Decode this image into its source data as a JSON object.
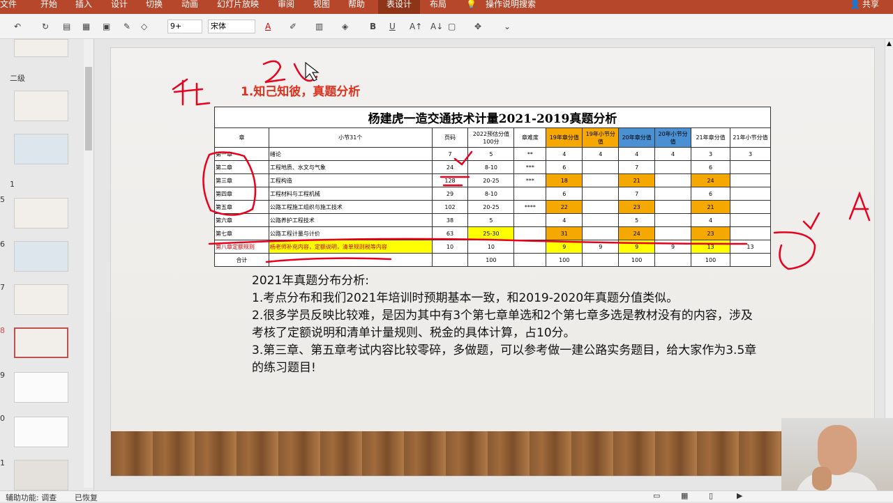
{
  "ribbon": {
    "tabs": [
      "文件",
      "开始",
      "插入",
      "设计",
      "切换",
      "动画",
      "幻灯片放映",
      "审阅",
      "视图",
      "帮助",
      "表设计",
      "布局"
    ],
    "search": "操作说明搜索",
    "share": "共享"
  },
  "toolbar": {
    "font_size": "9+",
    "font_name": "宋体"
  },
  "thumbs": {
    "labels": [
      "二级",
      "1",
      "5",
      "6",
      "7",
      "8",
      "9",
      "0",
      "1"
    ]
  },
  "status": {
    "accessibility": "辅助功能: 调查",
    "restored": "已恢复"
  },
  "slide": {
    "subtitle": "1.知己知彼，真题分析",
    "table_title": "杨建虎一造交通技术计量2021-2019真题分析",
    "headers": [
      "章",
      "小节31个",
      "页码",
      "2022预估分值100分",
      "章难度",
      "19年章分值",
      "19年小节分值",
      "20年章分值",
      "20年小节分值",
      "21年章分值",
      "21年小节分值"
    ],
    "rows": [
      [
        "第一章",
        "绪论",
        "7",
        "5",
        "**",
        "4",
        "4",
        "4",
        "4",
        "3",
        "3"
      ],
      [
        "第二章",
        "工程地质、水文与气象",
        "24",
        "8-10",
        "***",
        "6",
        "",
        "7",
        "",
        "6",
        ""
      ],
      [
        "第三章",
        "工程构造",
        "128",
        "20-25",
        "***",
        "18",
        "",
        "21",
        "",
        "24",
        ""
      ],
      [
        "第四章",
        "工程材料与工程机械",
        "29",
        "8-10",
        "",
        "6",
        "",
        "7",
        "",
        "6",
        ""
      ],
      [
        "第五章",
        "公路工程施工组织与施工技术",
        "102",
        "20-25",
        "****",
        "22",
        "",
        "23",
        "",
        "21",
        ""
      ],
      [
        "第六章",
        "公路养护工程技术",
        "38",
        "5",
        "",
        "4",
        "",
        "5",
        "",
        "4",
        ""
      ],
      [
        "第七章",
        "公路工程计量与计价",
        "63",
        "25-30",
        "",
        "31",
        "",
        "24",
        "",
        "23",
        ""
      ],
      [
        "第八章定额规则",
        "杨老师补充内容，定额说明，清单规则税等内容",
        "10",
        "10",
        "",
        "9",
        "9",
        "9",
        "9",
        "13",
        "13"
      ],
      [
        "合计",
        "",
        "",
        "100",
        "",
        "100",
        "",
        "100",
        "",
        "100",
        ""
      ]
    ],
    "analysis_title": "2021年真题分布分析:",
    "points": [
      "1.考点分布和我们2021年培训时预期基本一致，和2019-2020年真题分值类似。",
      "2.很多学员反映比较难，是因为其中有3个第七章单选和2个第七章多选是教材没有的内容，涉及考核了定额说明和清单计量规则、税金的具体计算，占10分。",
      "3.第三章、第五章考试内容比较零碎，多做题，可以参考做一建公路实务题目，给大家作为3.5章的练习题目!"
    ]
  },
  "colors": {
    "ribbon": "#b7472a",
    "orange": "#f4a800",
    "blue": "#4a90d2",
    "yellow": "#ffff00",
    "ink": "#e8001c"
  }
}
